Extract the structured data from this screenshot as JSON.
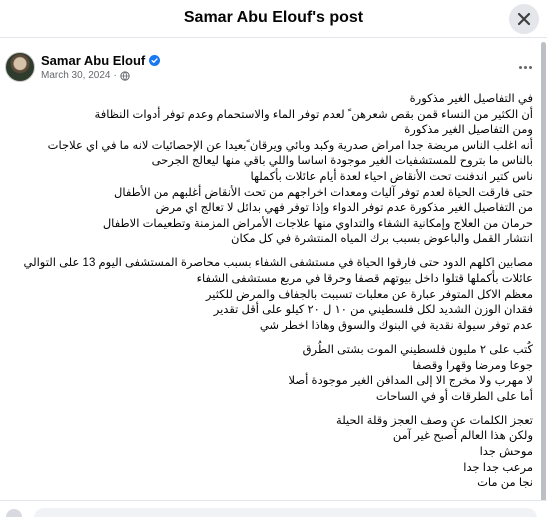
{
  "dialog": {
    "title": "Samar Abu Elouf's post"
  },
  "post": {
    "author": "Samar Abu Elouf",
    "date": "March 30, 2024",
    "separator": "·",
    "paragraphs": [
      [
        "في التفاصيل الغير مذكورة",
        "أن الكثير من النساء قمن بقص شعرهن ً لعدم توفر الماء والاستحمام وعدم توفر أدوات النظافة",
        "ومن التفاصيل الغير مذكورة",
        "أنه اغلب الناس مريضة جدا امراض صدرية وكبد وبائي ويرقان ًبعيدا عن الإحصائيات لانه ما في اي علاجات",
        "بالناس ما بتروح للمستشفيات الغير موجودة اساسا واللي باقي منها ليعالج الجرحى",
        "ناس كتير اندفنت تحت الأنقاض احياء لعدة أيام عائلات بأكملها",
        "حتى فارقت الحياة لعدم توفر آليات ومعدات اخراجهم من تحت الأنقاض أغلبهم من الأطفال",
        "من التفاصيل الغير مذكورة عدم توفر الدواء وإذا توفر فهي بدائل لا تعالج اي مرض",
        "حرمان من العلاج وإمكانية الشفاء والتداوي منها علاجات الأمراض المزمنة وتطعيمات الاطفال",
        "انتشار القمل والباعوض بسبب برك المياه المنتشرة في كل مكان"
      ],
      [
        "مصابين اكلهم الدود حتى فارقوا الحياة في مستشفى الشفاء بسبب محاصرة المستشفى اليوم 13 على التوالي",
        "عائلات بأكملها قتلوا داخل بيوتهم قصفا وحرقا في مربع مستشفى الشفاء",
        "معظم الاكل المتوفر عبارة عن معلبات تسببت بالجفاف والمرض للكثير",
        "فقدان الوزن الشديد لكل فلسطيني من ١٠ ل ٢٠ كيلو على أقل تقدير",
        "عدم توفر سيولة نقدية في البنوك والسوق وهاذا اخطر شي"
      ],
      [
        "كُتب على ٢ مليون فلسطيني الموت بشتى الطُرق",
        "جوعا ومرضا وقهرا وقصفا",
        "لا مهرب ولا مخرج الا إلى المدافن الغير موجودة أصلا",
        "أما على الطرقات أو في الساحات"
      ],
      [
        "تعجز الكلمات عن وصف العجز وقلة الحيلة",
        "ولكن هذا العالم أصبح غير آمن",
        "موحش جدا",
        "مرعب جدا جدا",
        "نجا من مات"
      ]
    ]
  },
  "icons": {
    "close": "close-icon",
    "verified": "verified-badge-icon",
    "privacy": "globe-icon",
    "more": "more-options-icon"
  },
  "colors": {
    "accent": "#1877f2",
    "secondary_text": "#65676b",
    "button_bg": "#e4e6eb"
  }
}
